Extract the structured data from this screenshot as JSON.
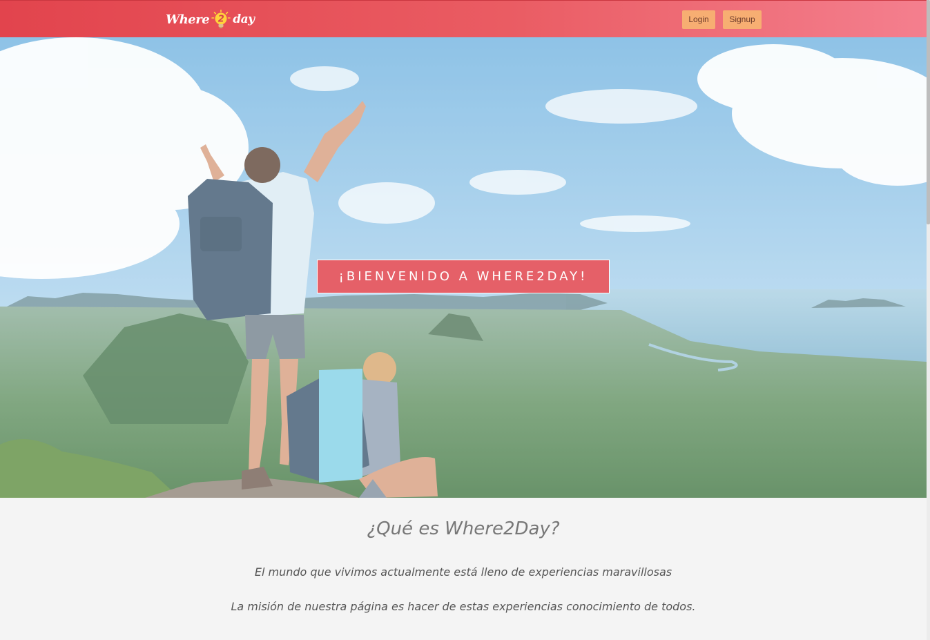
{
  "navbar": {
    "logo": {
      "part1": "Where",
      "digit": "2",
      "part2": "day"
    },
    "login_label": "Login",
    "signup_label": "Signup",
    "gradient": [
      "#e2444d",
      "#f47f8e"
    ],
    "button_color": "#f7ae72"
  },
  "hero": {
    "welcome_text": "¡BIENVENIDO A WHERE2DAY!",
    "welcome_bg": "#e8565e"
  },
  "about": {
    "heading": "¿Qué es Where2Day?",
    "paragraph1": "El mundo que vivimos actualmente está lleno de experiencias maravillosas",
    "paragraph2": "La misión de nuestra página es hacer de estas experiencias conocimiento de todos."
  },
  "icons": {
    "logo_icon": "lightbulb-icon"
  }
}
